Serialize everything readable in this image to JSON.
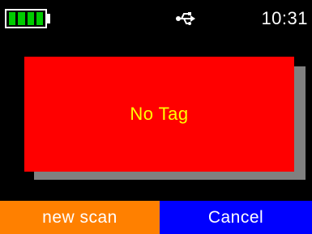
{
  "status_bar": {
    "battery_icon": "battery-full-icon",
    "battery_bars": 4,
    "usb_icon": "usb-icon",
    "time": "10:31"
  },
  "message": {
    "text": "No Tag"
  },
  "soft_keys": {
    "left_label": "new scan",
    "right_label": "Cancel"
  },
  "colors": {
    "background": "#000000",
    "battery": "#00cc00",
    "card": "#ff0000",
    "card_shadow": "#808080",
    "message_text": "#ffff00",
    "left_key": "#ff8000",
    "right_key": "#0000ff"
  }
}
